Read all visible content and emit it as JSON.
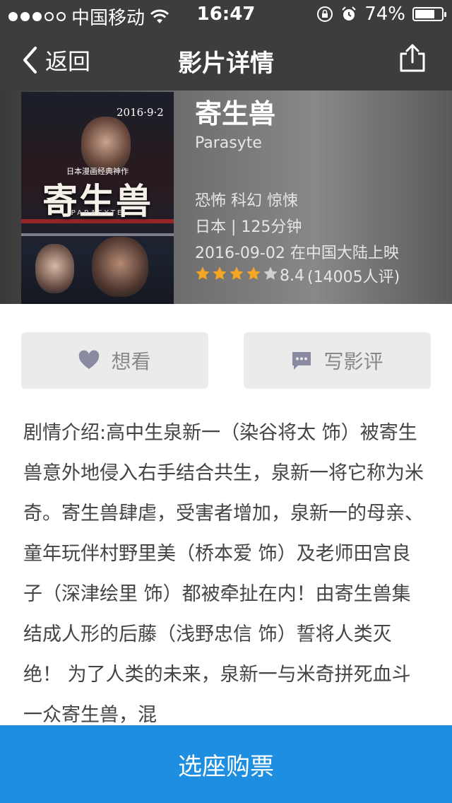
{
  "status_bar": {
    "carrier": "中国移动",
    "time": "16:47",
    "battery": "74%",
    "battery_level": 0.74,
    "signal_filled": 3,
    "signal_total": 5
  },
  "nav": {
    "back_label": "返回",
    "title": "影片详情"
  },
  "movie": {
    "title": "寄生兽",
    "english_title": "Parasyte",
    "genres": "恐怖 科幻 惊悚",
    "country_duration": "日本 | 125分钟",
    "release": "2016-09-02 在中国大陆上映",
    "rating": "8.4",
    "rating_stars_filled": 4,
    "rating_count": "(14005人评)",
    "poster": {
      "date": "2016·9·2",
      "tagline": "日本漫画经典神作",
      "title": "寄生兽",
      "latin": "PARASYTE"
    }
  },
  "actions": {
    "want_label": "想看",
    "review_label": "写影评"
  },
  "synopsis": {
    "label": "剧情介绍:",
    "text": "高中生泉新一（染谷将太 饰）被寄生兽意外地侵入右手结合共生，泉新一将它称为米奇。寄生兽肆虐，受害者增加，泉新一的母亲、童年玩伴村野里美（桥本爱 饰）及老师田宫良子（深津绘里 饰）都被牵扯在内！由寄生兽集结成人形的后藤（浅野忠信 饰）誓将人类灭绝！ 为了人类的未来，泉新一与米奇拼死血斗一众寄生兽，混"
  },
  "buy_button": "选座购票",
  "colors": {
    "bar": "#3d3d3d",
    "accent": "#1d8ee0",
    "star": "#f5a623",
    "button_bg": "#ebebeb",
    "icon": "#8a8aa0"
  },
  "icons": {
    "back": "chevron-left-icon",
    "share": "share-icon",
    "want": "heart-icon",
    "review": "comment-icon",
    "wifi": "wifi-icon",
    "lock": "rotation-lock-icon",
    "alarm": "alarm-icon"
  }
}
